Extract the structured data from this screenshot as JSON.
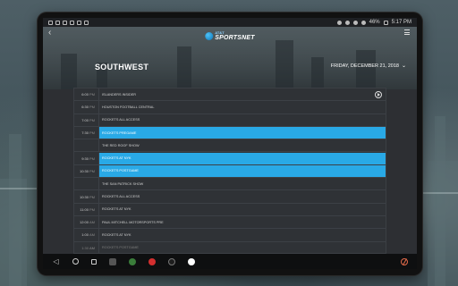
{
  "status_bar": {
    "battery": "46%",
    "time": "5:17 PM"
  },
  "header": {
    "logo_line1": "AT&T",
    "logo_line2": "SPORTSNET",
    "region": "SOUTHWEST",
    "date": "FRIDAY, DECEMBER 21, 2018"
  },
  "schedule": [
    {
      "time": "6:00",
      "ampm": "PM",
      "title": "ISLANDERS INSIDER",
      "state": "normal",
      "play": true
    },
    {
      "time": "6:30",
      "ampm": "PM",
      "title": "HOUSTON FOOTBALL CENTRAL",
      "state": "normal",
      "play": false
    },
    {
      "time": "7:00",
      "ampm": "PM",
      "title": "ROCKETS ALL ACCESS",
      "state": "normal",
      "play": false
    },
    {
      "time": "7:30",
      "ampm": "PM",
      "title": "ROCKETS PREGAME",
      "state": "highlight",
      "play": false
    },
    {
      "time": "",
      "ampm": "",
      "title": "THE RED ROOF SHOW",
      "state": "normal",
      "play": false
    },
    {
      "time": "9:30",
      "ampm": "PM",
      "title": "ROCKETS AT NYK",
      "state": "highlight",
      "play": false
    },
    {
      "time": "10:30",
      "ampm": "PM",
      "title": "ROCKETS POSTGAME",
      "state": "highlight",
      "play": false
    },
    {
      "time": "",
      "ampm": "",
      "title": "THE SAN PATRICK SHOW",
      "state": "normal",
      "play": false
    },
    {
      "time": "10:30",
      "ampm": "PM",
      "title": "ROCKETS ALL ACCESS",
      "state": "normal",
      "play": false
    },
    {
      "time": "11:00",
      "ampm": "PM",
      "title": "ROCKETS AT NYK",
      "state": "normal",
      "play": false
    },
    {
      "time": "12:00",
      "ampm": "AM",
      "title": "PAUL MITCHELL MOTORSPORTS PRE",
      "state": "normal",
      "play": false
    },
    {
      "time": "1:00",
      "ampm": "AM",
      "title": "ROCKETS AT NYK",
      "state": "normal",
      "play": false
    },
    {
      "time": "1:30",
      "ampm": "AM",
      "title": "ROCKETS POSTGAME",
      "state": "dim",
      "play": false
    }
  ],
  "colors": {
    "highlight": "#29a9e6",
    "row_bg": "#2f3236",
    "app_red": "#d32f2f"
  },
  "navbar": {
    "icons": [
      "back-icon",
      "home-icon",
      "recents-icon",
      "app-icon-grid",
      "app-icon-red",
      "app-icon-dark",
      "app-icon-clock"
    ]
  }
}
